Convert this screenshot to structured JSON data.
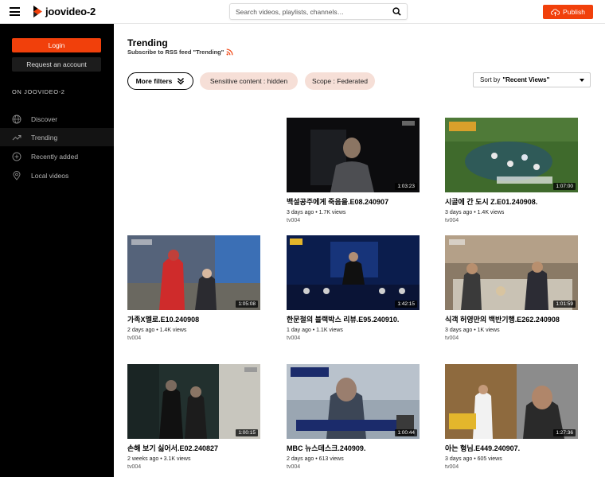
{
  "header": {
    "brand": "joovideo-2",
    "search_placeholder": "Search videos, playlists, channels…",
    "publish_label": "Publish"
  },
  "sidebar": {
    "login_label": "Login",
    "signup_label": "Request an account",
    "section_title": "ON JOOVIDEO-2",
    "items": [
      {
        "label": "Discover",
        "icon": "globe-icon"
      },
      {
        "label": "Trending",
        "icon": "trending-icon",
        "active": true
      },
      {
        "label": "Recently added",
        "icon": "plus-circle-icon"
      },
      {
        "label": "Local videos",
        "icon": "location-icon"
      }
    ]
  },
  "main": {
    "title": "Trending",
    "rss_label": "Subscribe to RSS feed \"Trending\"",
    "more_filters_label": "More filters",
    "chips": [
      "Sensitive content : hidden",
      "Scope : Federated"
    ],
    "sort_prefix": "Sort by",
    "sort_value": "\"Recent Views\""
  },
  "videos": [
    {
      "title": "백설공주에게 죽음을.E08.240907",
      "meta": "3 days ago • 1.7K views",
      "channel": "tv004",
      "duration": "1:03:23"
    },
    {
      "title": "시골에 간 도시 Z.E01.240908.",
      "meta": "3 days ago • 1.4K views",
      "channel": "tv004",
      "duration": "1:07:00"
    },
    {
      "title": "가족X멜로.E10.240908",
      "meta": "2 days ago • 1.4K views",
      "channel": "tv004",
      "duration": "1:05:08"
    },
    {
      "title": "한문철의 블랙박스 리뷰.E95.240910.",
      "meta": "1 day ago • 1.1K views",
      "channel": "tv004",
      "duration": "1:42:15"
    },
    {
      "title": "식객 허영만의 백반기행.E262.240908",
      "meta": "3 days ago • 1K views",
      "channel": "tv004",
      "duration": "1:01:59"
    },
    {
      "title": "손해 보기 싫어서.E02.240827",
      "meta": "2 weeks ago • 3.1K views",
      "channel": "tv004",
      "duration": "1:00:15"
    },
    {
      "title": "MBC 뉴스데스크.240909.",
      "meta": "2 days ago • 613 views",
      "channel": "tv004",
      "duration": "1:00:44"
    },
    {
      "title": "아는 형님.E449.240907.",
      "meta": "3 days ago • 605 views",
      "channel": "tv004",
      "duration": "1:27:36"
    }
  ],
  "colors": {
    "accent": "#f1400b",
    "chip_bg": "#f6dfd7",
    "sidebar_bg": "#000000"
  }
}
